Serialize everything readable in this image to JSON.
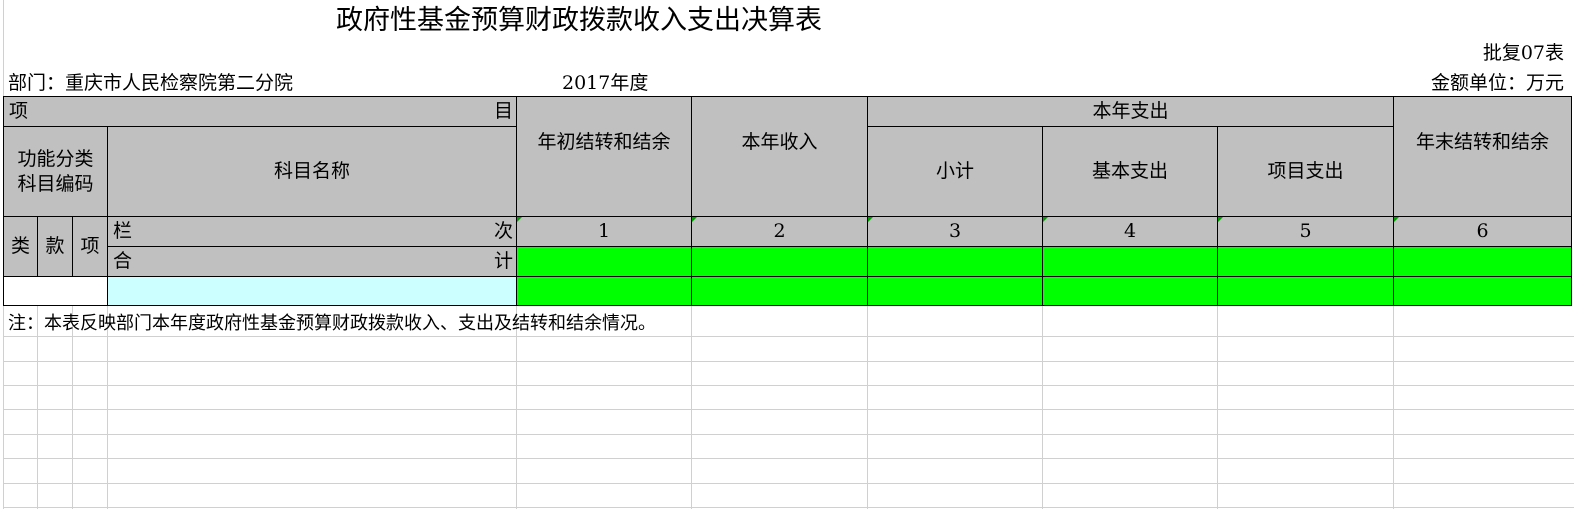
{
  "report": {
    "title": "政府性基金预算财政拨款收入支出决算表",
    "form_no": "批复07表",
    "department": "部门：重庆市人民检察院第二分院",
    "year": "2017年度",
    "unit": "金额单位：万元",
    "note": "注：本表反映部门本年度政府性基金预算财政拨款收入、支出及结转和结余情况。"
  },
  "header": {
    "item_left": "项",
    "item_right": "目",
    "func_code": "功能分类\n科目编码",
    "subject_name": "科目名称",
    "col_lei": "类",
    "col_kuan": "款",
    "col_xiang": "项",
    "lan": "栏",
    "ci": "次",
    "he": "合",
    "ji": "计",
    "begin_balance": "年初结转和结余",
    "income": "本年收入",
    "expense_group": "本年支出",
    "subtotal": "小计",
    "basic_expense": "基本支出",
    "project_expense": "项目支出",
    "end_balance": "年末结转和结余"
  },
  "column_numbers": [
    "1",
    "2",
    "3",
    "4",
    "5",
    "6"
  ]
}
